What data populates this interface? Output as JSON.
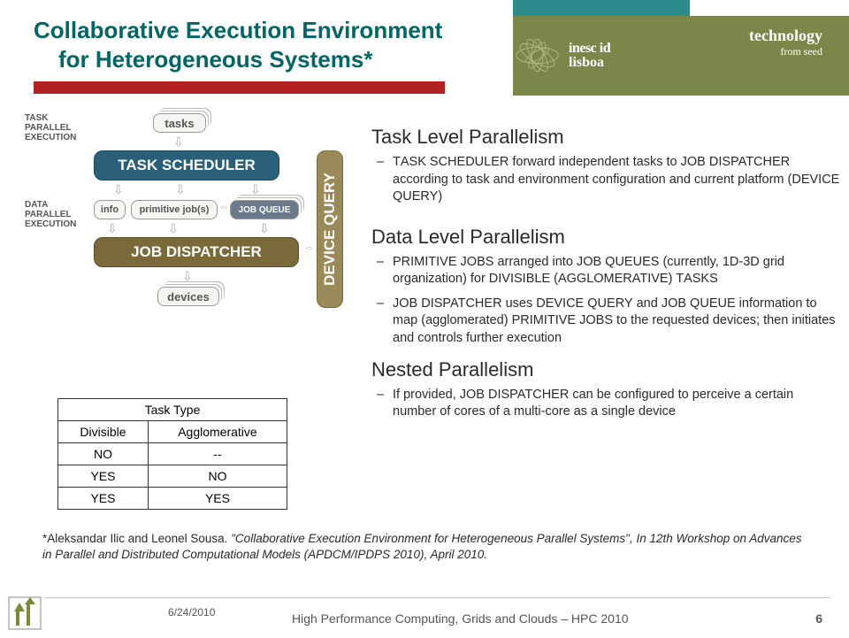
{
  "header": {
    "title_line1": "Collaborative Execution Environment",
    "title_line2": "for Heterogeneous Systems*",
    "logo_top": "inesc id",
    "logo_bot": "lisboa",
    "tech_line1": "technology",
    "tech_line2": "from seed"
  },
  "diagram": {
    "task_parallel": "TASK PARALLEL EXECUTION",
    "data_parallel": "DATA PARALLEL EXECUTION",
    "tasks": "tasks",
    "task_scheduler": "TASK SCHEDULER",
    "info": "info",
    "primitive_jobs": "primitive job(s)",
    "job_queue": "JOB QUEUE",
    "job_dispatcher": "JOB DISPATCHER",
    "devices": "devices",
    "device_query": "DEVICE QUERY"
  },
  "task_table": {
    "header": "Task Type",
    "col1": "Divisible",
    "col2": "Agglomerative",
    "rows": [
      [
        "NO",
        "--"
      ],
      [
        "YES",
        "NO"
      ],
      [
        "YES",
        "YES"
      ]
    ]
  },
  "sections": {
    "s1_title": "Task Level Parallelism",
    "s1_b1": "TASK SCHEDULER forward independent tasks to JOB DISPATCHER according to task and environment configuration and current platform (DEVICE QUERY)",
    "s2_title": "Data Level Parallelism",
    "s2_b1": "PRIMITIVE JOBS arranged into JOB QUEUES (currently, 1D-3D grid organization) for DIVISIBLE (AGGLOMERATIVE) TASKS",
    "s2_b2": "JOB DISPATCHER uses DEVICE QUERY and JOB QUEUE information to map (agglomerated) PRIMITIVE JOBS to the requested devices; then initiates and controls further execution",
    "s3_title": "Nested Parallelism",
    "s3_b1": "If provided, JOB DISPATCHER can be configured to perceive a certain number of cores of a multi-core as a single device"
  },
  "citation": "*Aleksandar Ilic and Leonel Sousa. \"Collaborative Execution Environment for Heterogeneous Parallel Systems\", In 12th Workshop on Advances in Parallel and Distributed Computational Models (APDCM/IPDPS 2010), April 2010.",
  "footer": {
    "date": "6/24/2010",
    "mid": "High Performance Computing, Grids and Clouds – HPC 2010",
    "page": "6"
  }
}
